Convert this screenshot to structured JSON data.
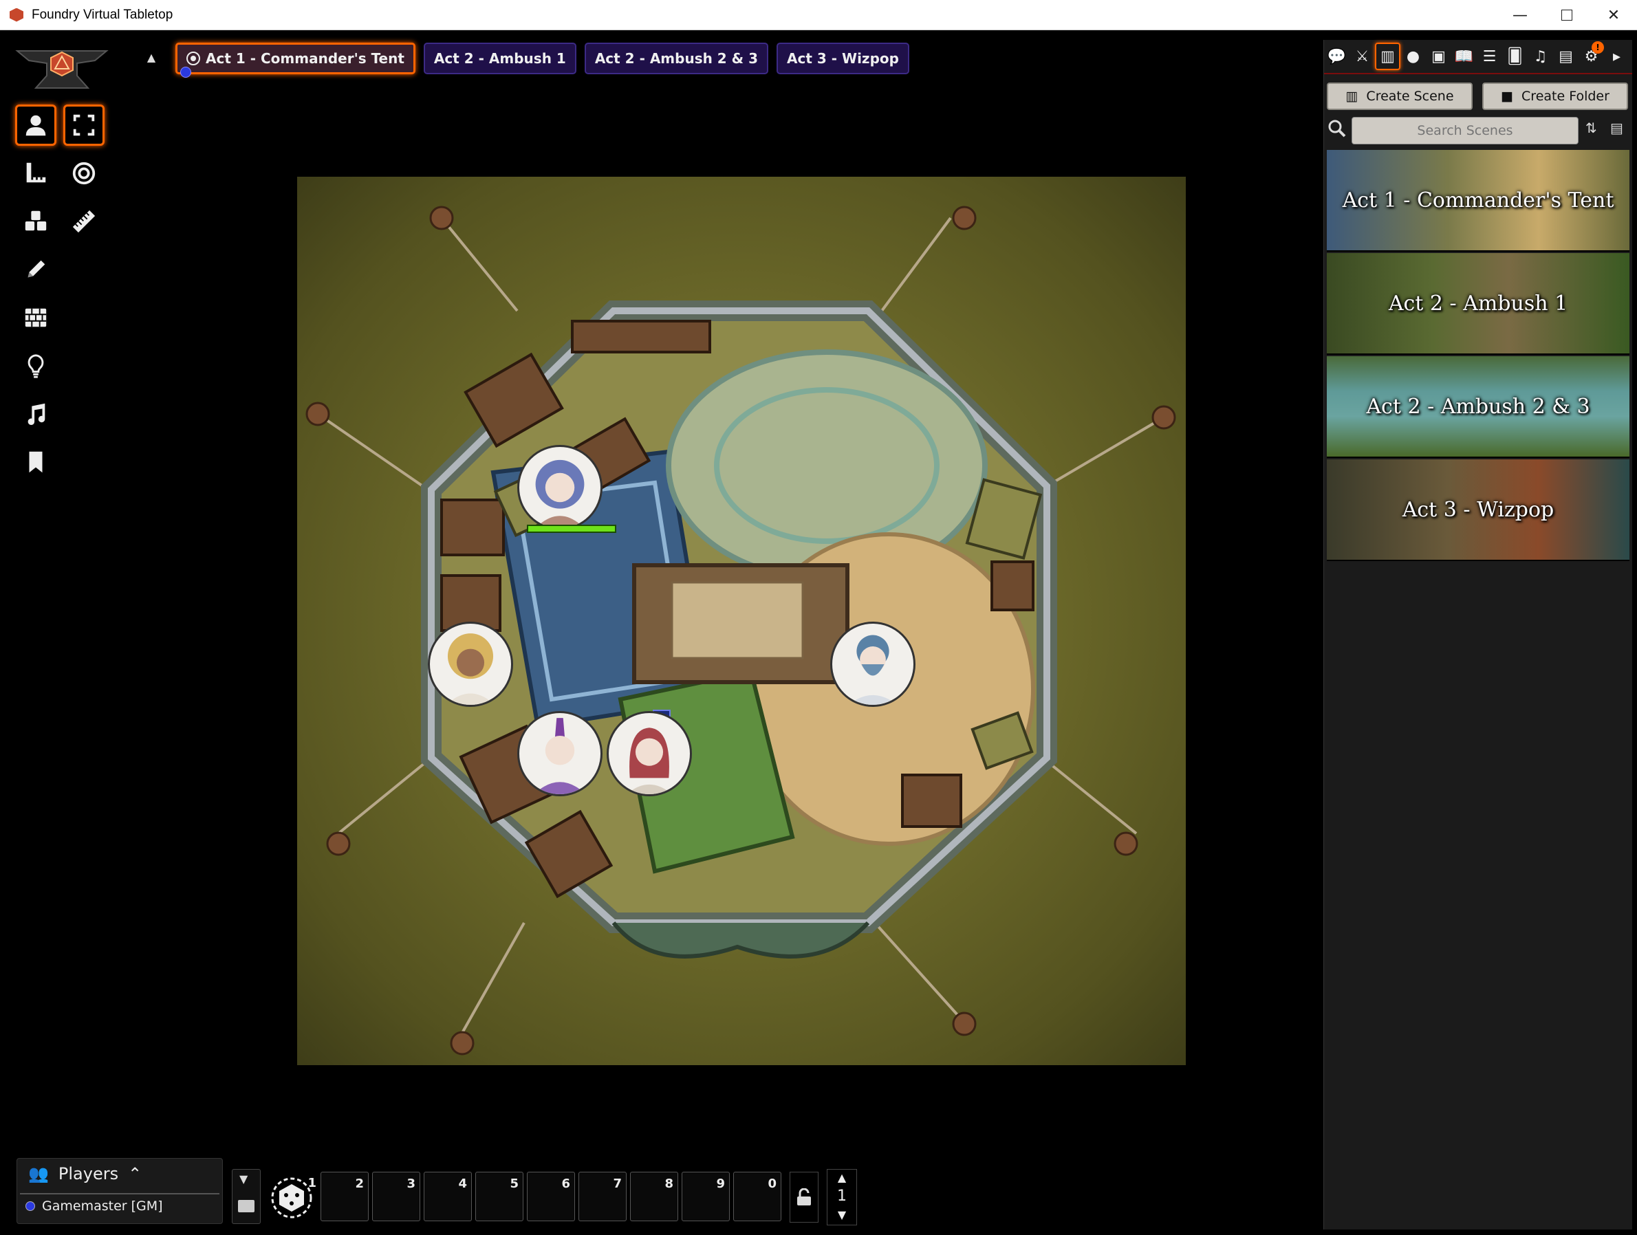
{
  "window": {
    "title": "Foundry Virtual Tabletop"
  },
  "navigation": {
    "scenes": [
      {
        "label": "Act 1 - Commander's Tent",
        "active": true
      },
      {
        "label": "Act 2 - Ambush 1",
        "active": false
      },
      {
        "label": "Act 2 - Ambush 2 & 3",
        "active": false
      },
      {
        "label": "Act 3 - Wizpop",
        "active": false
      }
    ],
    "gm_marker": "G"
  },
  "controls": [
    {
      "name": "token-control",
      "icon": "user-icon",
      "active": true
    },
    {
      "name": "select-control",
      "icon": "expand-icon",
      "active": true
    },
    {
      "name": "measure-control",
      "icon": "ruler-square-icon",
      "active": false
    },
    {
      "name": "target-control",
      "icon": "bullseye-icon",
      "active": false
    },
    {
      "name": "tiles-control",
      "icon": "cubes-icon",
      "active": false
    },
    {
      "name": "ruler-control",
      "icon": "ruler-icon",
      "active": false
    },
    {
      "name": "drawing-control",
      "icon": "pencil-icon",
      "active": false
    },
    {
      "name": "walls-control",
      "icon": "brick-wall-icon",
      "active": false
    },
    {
      "name": "lighting-control",
      "icon": "lightbulb-icon",
      "active": false
    },
    {
      "name": "sounds-control",
      "icon": "music-icon",
      "active": false
    },
    {
      "name": "notes-control",
      "icon": "bookmark-icon",
      "active": false
    }
  ],
  "sidebar": {
    "tabs": [
      "chat-icon",
      "combat-icon",
      "scenes-icon",
      "actors-icon",
      "items-icon",
      "journal-icon",
      "tables-icon",
      "cards-icon",
      "playlists-icon",
      "compendium-icon",
      "settings-icon",
      "collapse-right-icon"
    ],
    "active_tab": "scenes-icon",
    "settings_notification": "!",
    "create_scene": "Create Scene",
    "create_folder": "Create Folder",
    "search_placeholder": "Search Scenes",
    "scenes": [
      {
        "label": "Act 1 - Commander's Tent",
        "color": "#6b6a3a"
      },
      {
        "label": "Act 2 - Ambush 1",
        "color": "#4b5a2a"
      },
      {
        "label": "Act 2 - Ambush 2 & 3",
        "color": "#3f6b6a"
      },
      {
        "label": "Act 3 - Wizpop",
        "color": "#5a4a2a"
      }
    ]
  },
  "players": {
    "title": "Players",
    "list": [
      {
        "name": "Gamemaster [GM]",
        "color": "#2b3ae0"
      }
    ]
  },
  "hotbar": {
    "slots": [
      "1",
      "2",
      "3",
      "4",
      "5",
      "6",
      "7",
      "8",
      "9",
      "0"
    ],
    "page": "1"
  },
  "colors": {
    "accent": "#ff6400",
    "nav_bg": "#1f1049",
    "hp_bar": "#6ee21a"
  }
}
